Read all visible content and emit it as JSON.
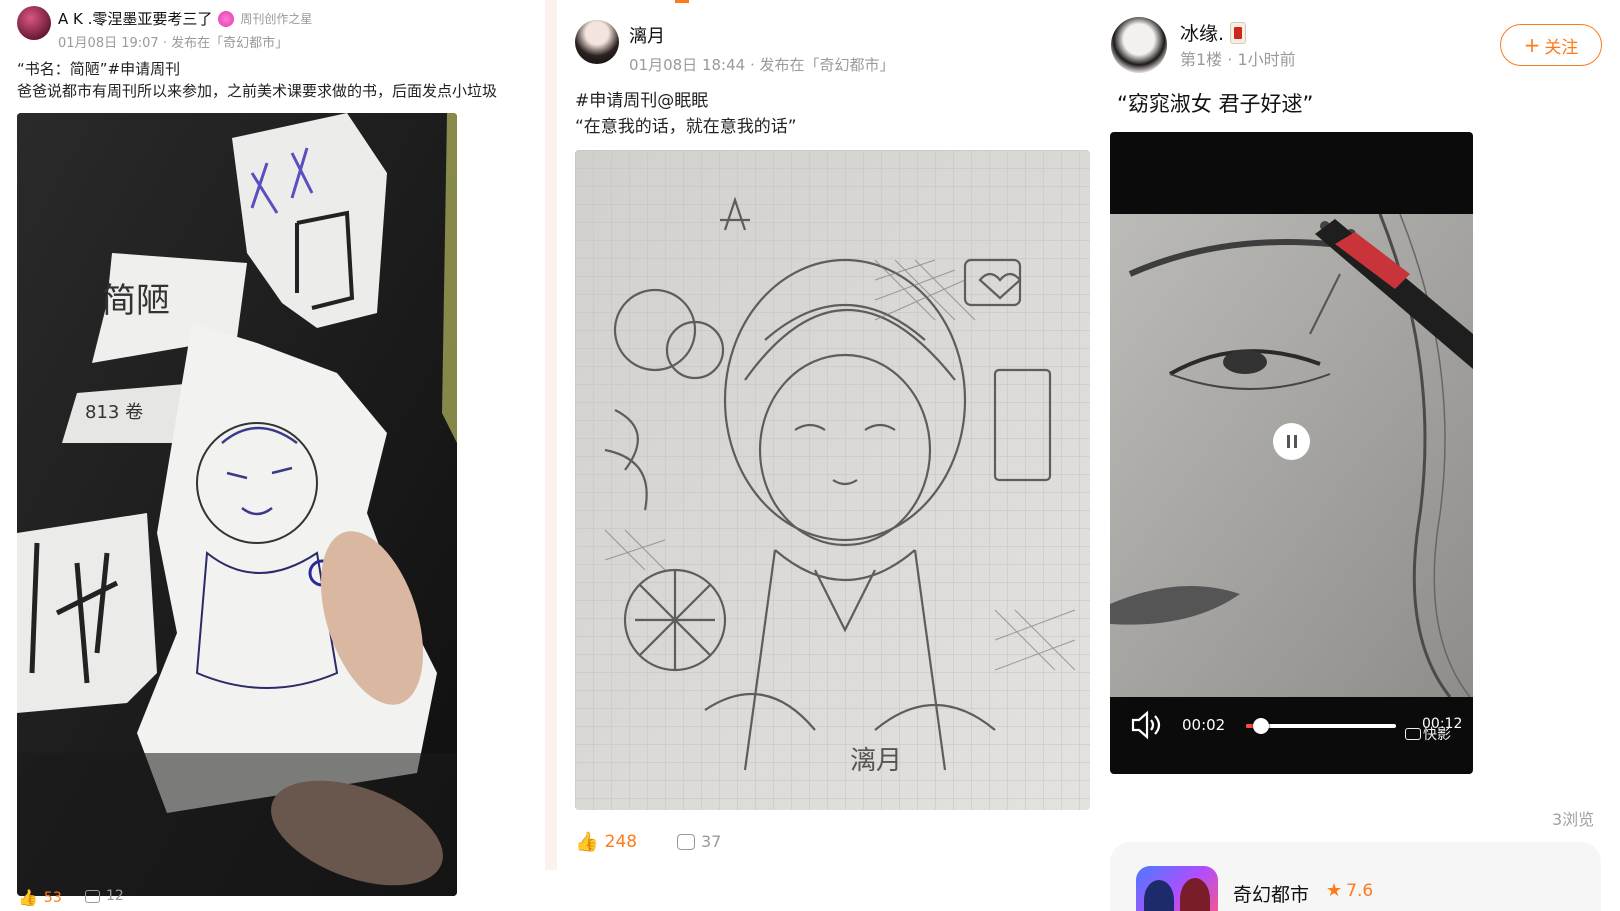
{
  "post1": {
    "author": "A K .零涅墨亚要考三了",
    "badge": "周刊创作之星",
    "meta": "01月08日 19:07 · 发布在「奇幻都市」",
    "line1": "“书名：简陋”#申请周刊",
    "line2": "爸爸说都市有周刊所以来参加，之前美术课要求做的书，后面发点小垃圾",
    "photo_label": "handmade paper book with blue-pen anime character drawing",
    "sign_text": "简陋",
    "sign_small": "813 卷",
    "likes": "53",
    "comments": "12"
  },
  "post2": {
    "author": "漓月",
    "meta": "01月08日 18:44 · 发布在「奇幻都市」",
    "line1": "#申请周刊@眠眠",
    "line2": "“在意我的话，就在意我的话”",
    "photo_label": "pencil drawing of anime girl on grid paper",
    "signature": "漓月",
    "likes": "248",
    "comments": "37"
  },
  "post3": {
    "author": "冰缘.",
    "floor_meta": "第1楼 · 1小时前",
    "follow_label": "关注",
    "quote": "“窈窕淑女 君子好逑”",
    "video_label": "pencil sketch of woman's face",
    "time_current": "00:02",
    "time_total": "00:12",
    "watermark": "快影",
    "views": "3浏览",
    "app_name": "奇幻都市",
    "app_rating": "7.6",
    "progress_fraction": 0.1
  },
  "colors": {
    "accent": "#ff7a1a",
    "gap": "#fdf1ee"
  }
}
